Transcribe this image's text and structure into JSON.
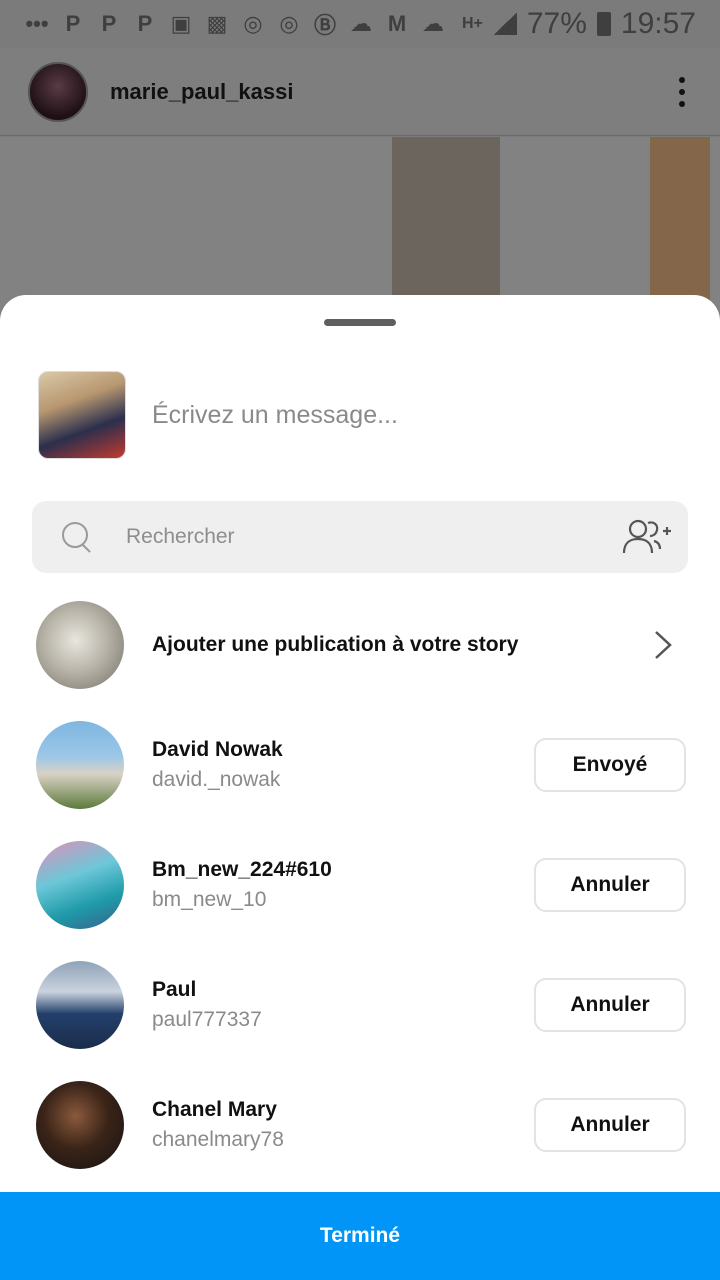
{
  "status_bar": {
    "battery": "77%",
    "time": "19:57",
    "network": "H+",
    "notification_icons": [
      "P",
      "P",
      "P"
    ]
  },
  "post": {
    "username": "marie_paul_kassi"
  },
  "share_sheet": {
    "message_placeholder": "Écrivez un message...",
    "search_placeholder": "Rechercher",
    "story_label": "Ajouter une publication à votre story",
    "recipients": [
      {
        "name": "David Nowak",
        "handle": "david._nowak",
        "action": "Envoyé"
      },
      {
        "name": "Bm_new_224#610",
        "handle": "bm_new_10",
        "action": "Annuler"
      },
      {
        "name": "Paul",
        "handle": "paul777337",
        "action": "Annuler"
      },
      {
        "name": "Chanel Mary",
        "handle": "chanelmary78",
        "action": "Annuler"
      }
    ],
    "done_label": "Terminé"
  },
  "colors": {
    "accent": "#0095f6",
    "sheet_bg": "#ffffff",
    "search_bg": "#efefef"
  }
}
